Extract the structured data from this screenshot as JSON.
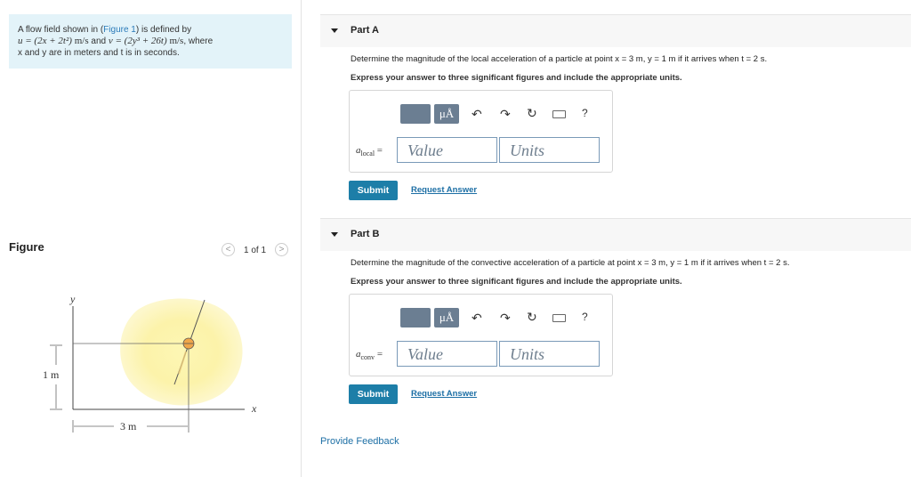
{
  "problem": {
    "line1_a": "A flow field shown in (",
    "line1_link": "Figure 1",
    "line1_b": ") is defined by",
    "u_expr": "u = (2x + 2t²)",
    "u_unit": "m/s",
    "and_text": " and ",
    "v_expr": "v = (2y³ + 26t)",
    "v_unit": "m/s",
    "where_text": ", where",
    "line3": "x and y are in meters and t is in seconds."
  },
  "figure": {
    "title": "Figure",
    "pager": "1 of 1",
    "y_axis_label": "y",
    "x_axis_label": "x",
    "dim_vertical": "1 m",
    "dim_horizontal": "3 m"
  },
  "parts": [
    {
      "title": "Part A",
      "question": "Determine the magnitude of the local acceleration of a particle at point x = 3 m, y = 1 m if it arrives when t = 2 s.",
      "instruction": "Express your answer to three significant figures and include the appropriate units.",
      "var_symbol": "a",
      "var_sub": "local",
      "equals": "=",
      "value_placeholder": "Value",
      "units_placeholder": "Units",
      "submit_label": "Submit",
      "request_label": "Request Answer"
    },
    {
      "title": "Part B",
      "question": "Determine the magnitude of the convective acceleration of a particle at point x = 3 m, y = 1 m if it arrives when t = 2 s.",
      "instruction": "Express your answer to three significant figures and include the appropriate units.",
      "var_symbol": "a",
      "var_sub": "conv",
      "equals": "=",
      "value_placeholder": "Value",
      "units_placeholder": "Units",
      "submit_label": "Submit",
      "request_label": "Request Answer"
    }
  ],
  "toolbar": {
    "mu_label": "μÅ",
    "help_label": "?"
  },
  "feedback": "Provide Feedback"
}
